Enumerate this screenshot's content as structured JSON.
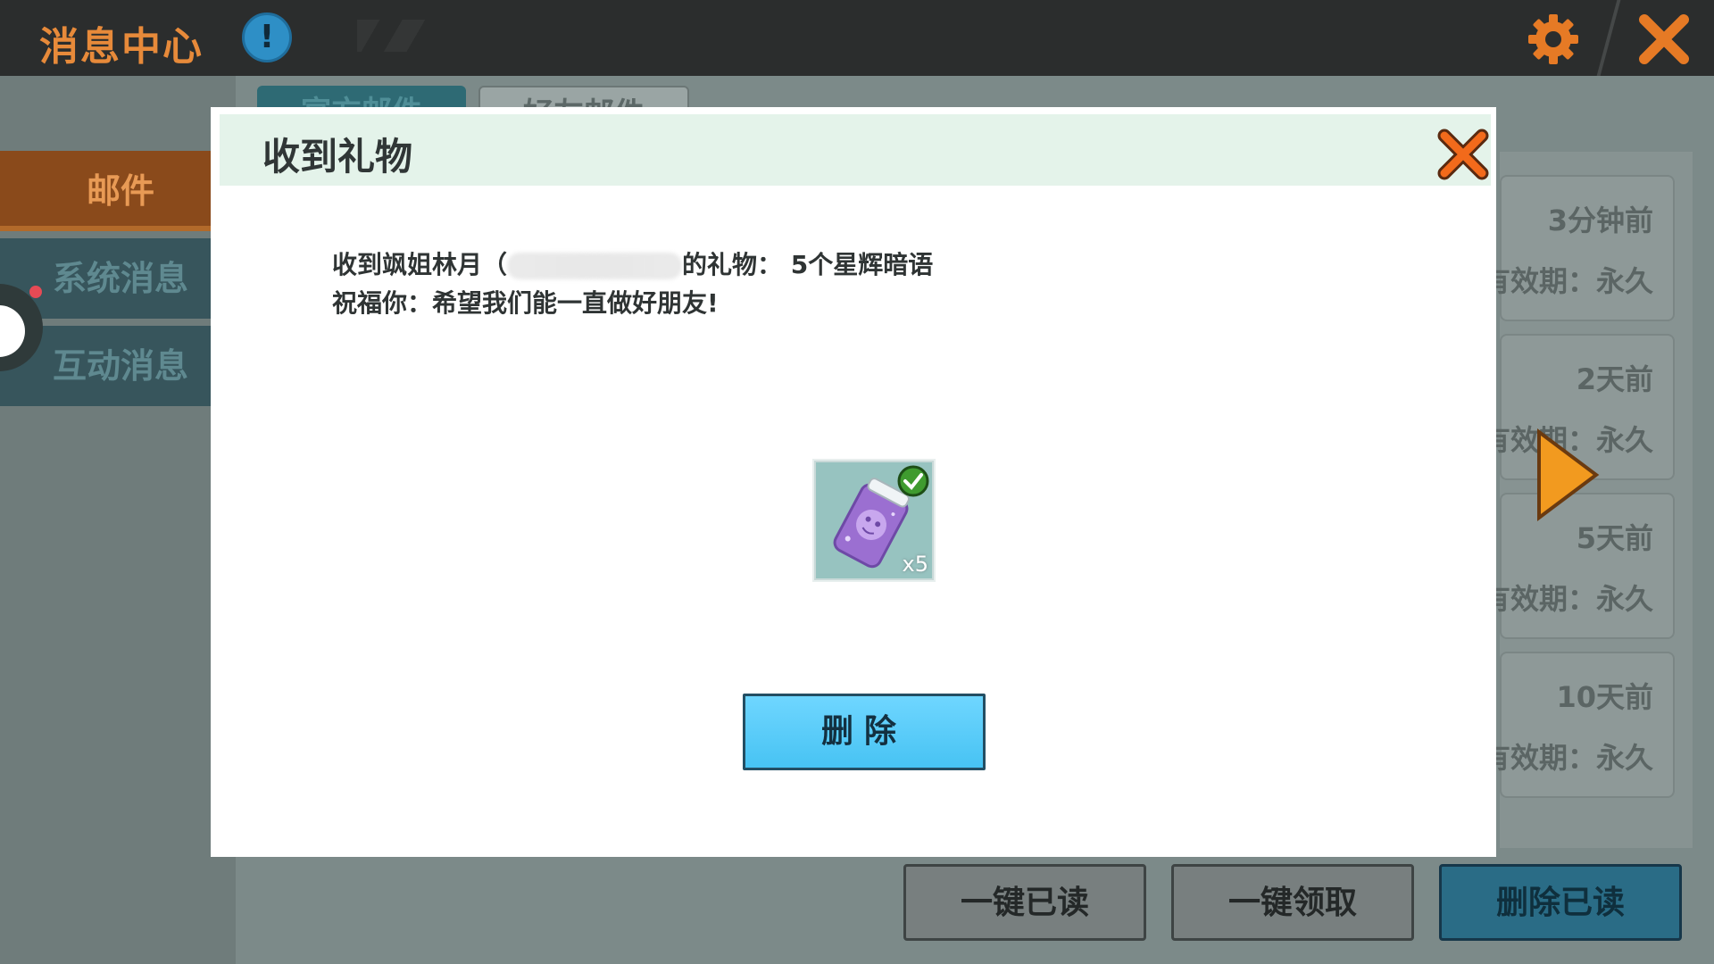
{
  "app": {
    "title": "消息中心"
  },
  "topbar": {
    "info_icon": "info-icon",
    "settings_icon": "gear-icon",
    "close_icon": "close-icon"
  },
  "sidebar": {
    "items": [
      {
        "label": "邮件",
        "active": true
      },
      {
        "label": "系统消息",
        "active": false
      },
      {
        "label": "互动消息",
        "active": false
      }
    ]
  },
  "tabs": [
    {
      "label": "官方邮件"
    },
    {
      "label": "好友邮件"
    }
  ],
  "mail_list": [
    {
      "time": "3分钟前",
      "expiry": "有效期：永久"
    },
    {
      "time": "2天前",
      "expiry": "有效期：永久"
    },
    {
      "time": "5天前",
      "expiry": "有效期：永久"
    },
    {
      "time": "10天前",
      "expiry": "有效期：永久"
    }
  ],
  "bottom_actions": {
    "read_all": "一键已读",
    "claim_all": "一键领取",
    "delete_read": "删除已读"
  },
  "modal": {
    "title": "收到礼物",
    "message_prefix": "收到飒姐林月（",
    "message_suffix": "的礼物：  5个星辉暗语",
    "message_line2": "祝福你：希望我们能一直做好朋友!",
    "gift": {
      "qty_label": "x5",
      "claimed": true
    },
    "delete_button": "删除"
  },
  "colors": {
    "accent_orange": "#e78a3a",
    "button_blue": "#47c3f3",
    "close_orange": "#f26a1b"
  }
}
